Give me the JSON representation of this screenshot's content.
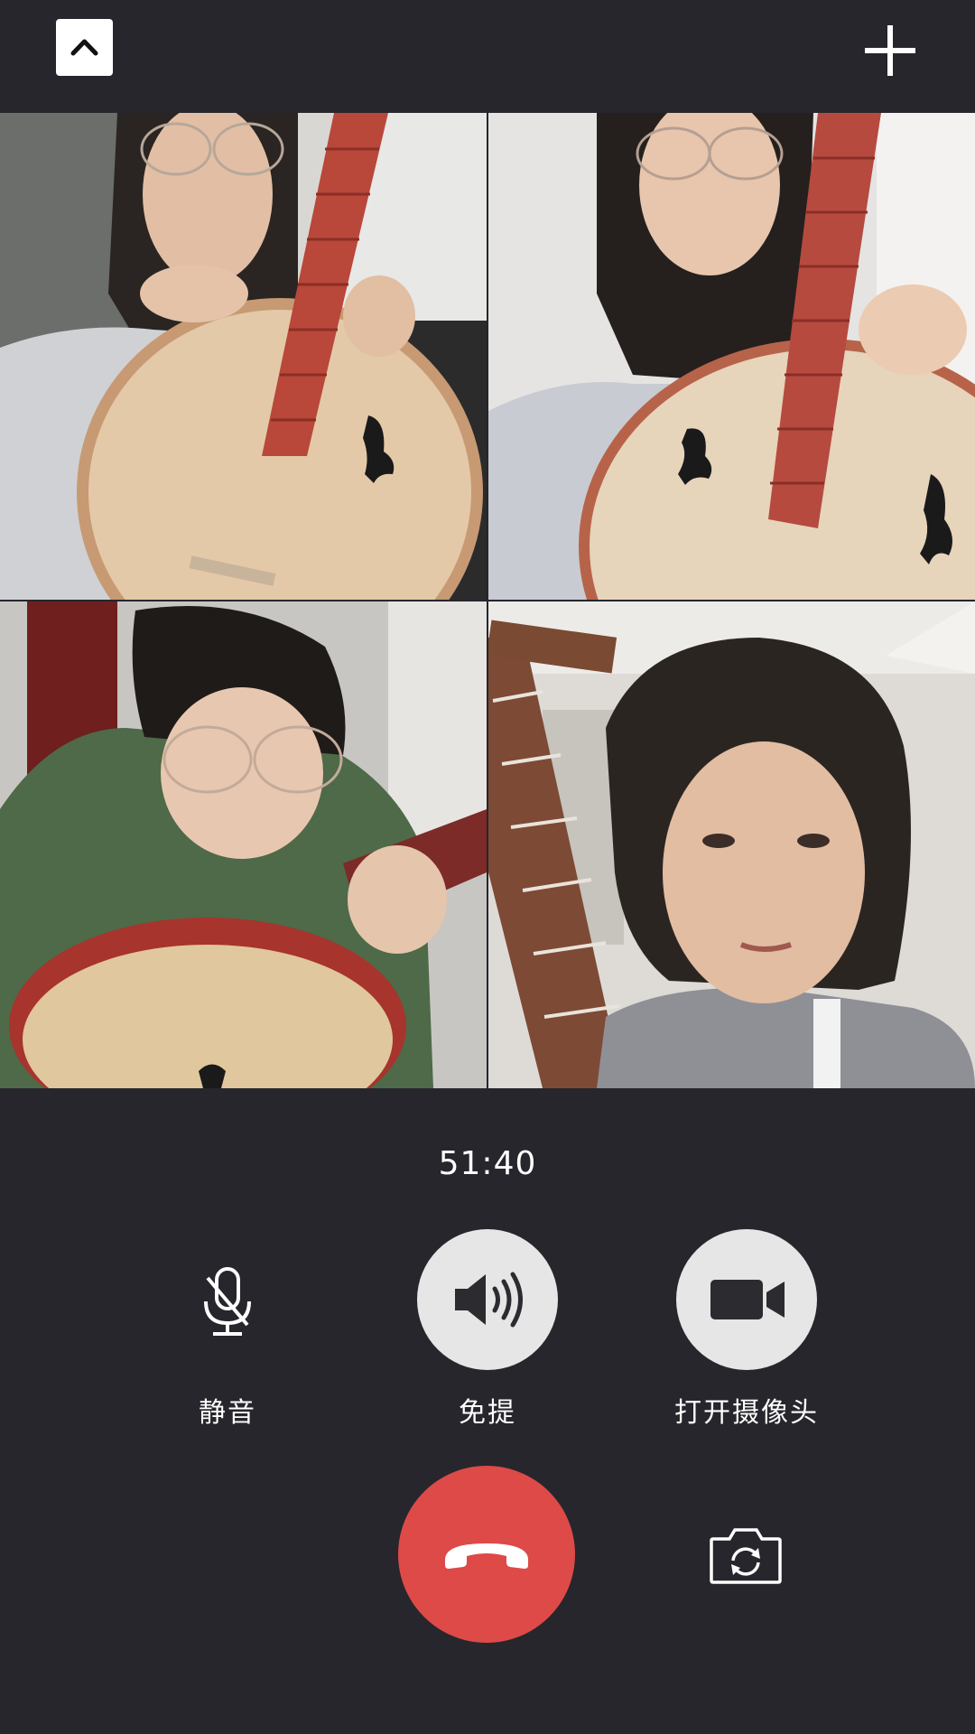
{
  "top_bar": {
    "minimize_icon": "chevron-up-icon",
    "add_icon": "plus-icon"
  },
  "participants": [
    {
      "id": 1,
      "instrument": "zhongruan",
      "image": "participant video feed"
    },
    {
      "id": 2,
      "instrument": "zhongruan",
      "image": "participant video feed"
    },
    {
      "id": 3,
      "instrument": "zhongruan",
      "image": "participant video feed"
    },
    {
      "id": 4,
      "instrument": "",
      "image": "participant video feed"
    }
  ],
  "call": {
    "duration": "51:40"
  },
  "controls": {
    "mute": {
      "label": "静音",
      "icon": "microphone-muted-icon",
      "active": false
    },
    "speaker": {
      "label": "免提",
      "icon": "speaker-icon",
      "active": true
    },
    "camera": {
      "label": "打开摄像头",
      "icon": "video-camera-icon",
      "active": true
    },
    "hangup": {
      "icon": "hangup-phone-icon"
    },
    "flip_camera": {
      "icon": "camera-switch-icon"
    }
  },
  "colors": {
    "background": "#26262c",
    "hangup": "#dd4a48",
    "control_fill": "#e6e6e6",
    "text": "#ffffff"
  }
}
